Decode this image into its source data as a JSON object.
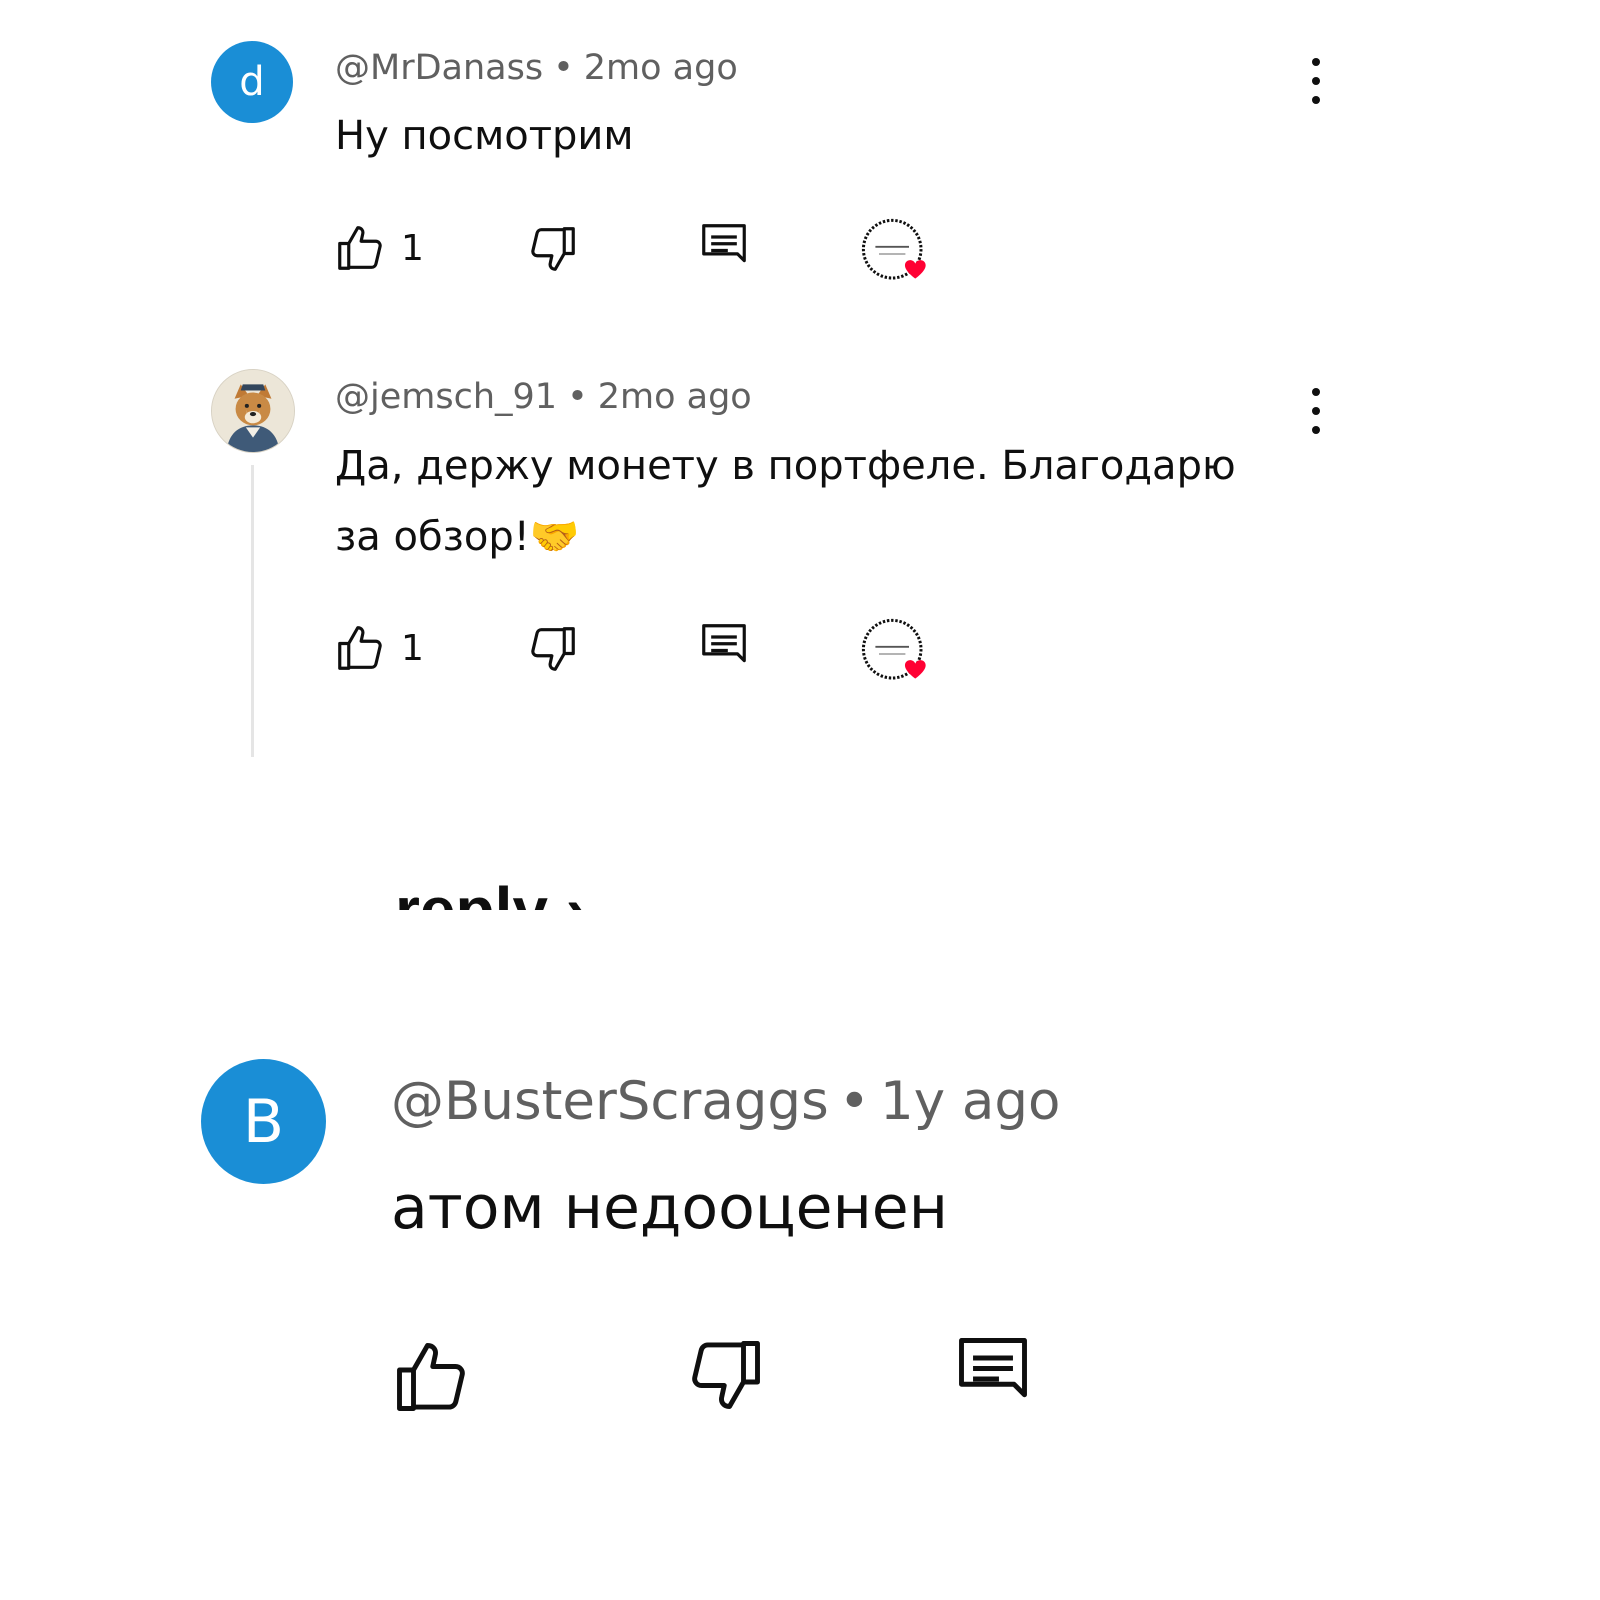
{
  "comments": [
    {
      "avatar_letter": "d",
      "handle": "@MrDanass",
      "separator": "•",
      "time": "2mo ago",
      "text": "Ну посмотрим",
      "likes": "1"
    },
    {
      "handle": "@jemsch_91",
      "separator": "•",
      "time": "2mo ago",
      "text_line1": "Да, держу монету в портфеле. Благодарю",
      "text_line2": "за обзор!🤝",
      "likes": "1"
    },
    {
      "avatar_letter": "B",
      "handle": "@BusterScraggs",
      "separator": "•",
      "time": "1y ago",
      "text": "атом недооценен"
    }
  ],
  "reply_link": {
    "label": "reply ›"
  },
  "colors": {
    "avatar_blue": "#1a8ed6",
    "heart": "#ff0033",
    "meta_gray": "#606060",
    "thread_line": "#e5e5e5"
  },
  "icons": [
    "thumb-up-icon",
    "thumb-down-icon",
    "reply-icon",
    "creator-heart-icon",
    "more-vert-icon"
  ]
}
